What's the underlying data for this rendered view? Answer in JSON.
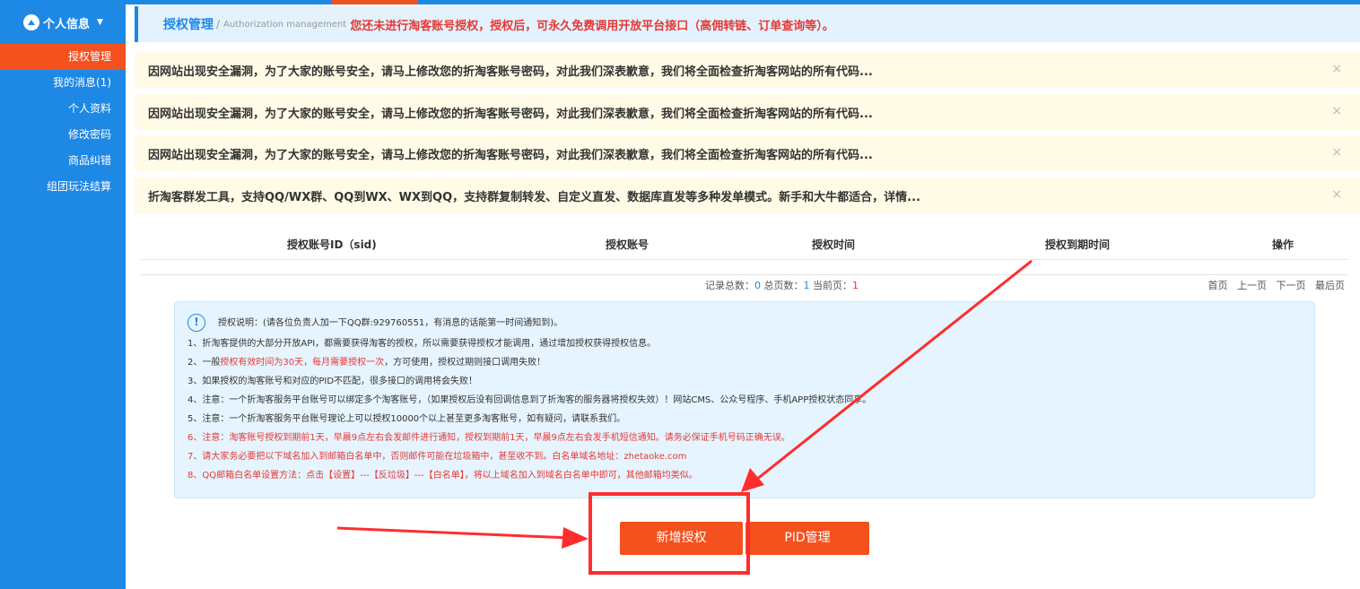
{
  "sidebar": {
    "header": "个人信息",
    "items": [
      {
        "label": "授权管理",
        "active": true
      },
      {
        "label": "我的消息(1)",
        "active": false
      },
      {
        "label": "个人资料",
        "active": false
      },
      {
        "label": "修改密码",
        "active": false
      },
      {
        "label": "商品纠错",
        "active": false
      },
      {
        "label": "组团玩法结算",
        "active": false
      }
    ]
  },
  "breadcrumb": {
    "title": "授权管理",
    "separator": "/",
    "subtitle": "Authorization management",
    "warning": "您还未进行淘客账号授权，授权后，可永久免费调用开放平台接口（高佣转链、订单查询等）。"
  },
  "notices": [
    {
      "text": "因网站出现安全漏洞，为了大家的账号安全，请马上修改您的折淘客账号密码，对此我们深表歉意，我们将全面检查折淘客网站的所有代码..."
    },
    {
      "text": "因网站出现安全漏洞，为了大家的账号安全，请马上修改您的折淘客账号密码，对此我们深表歉意，我们将全面检查折淘客网站的所有代码..."
    },
    {
      "text": "因网站出现安全漏洞，为了大家的账号安全，请马上修改您的折淘客账号密码，对此我们深表歉意，我们将全面检查折淘客网站的所有代码..."
    },
    {
      "text": "折淘客群发工具，支持QQ/WX群、QQ到WX、WX到QQ，支持群复制转发、自定义直发、数据库直发等多种发单模式。新手和大牛都适合，详情..."
    }
  ],
  "notice_close": "×",
  "table": {
    "columns": [
      "授权账号ID（sid)",
      "授权账号",
      "授权时间",
      "授权到期时间",
      "操作"
    ]
  },
  "pager": {
    "total_label": "记录总数：",
    "total": "0",
    "pages_label": "总页数：",
    "pages": "1",
    "current_label": "当前页：",
    "current": "1",
    "links": [
      "首页",
      "上一页",
      "下一页",
      "最后页"
    ]
  },
  "info": {
    "icon": "!",
    "header": "授权说明：(请各位负责人加一下QQ群:929760551，有消息的话能第一时间通知到)。",
    "line1": "1、折淘客提供的大部分开放API，都需要获得淘客的授权，所以需要获得授权才能调用，通过增加授权获得授权信息。",
    "line2_a": "2、一般",
    "line2_b": "授权有效时间为30天，每月需要授权一次",
    "line2_c": "，方可使用，授权过期则接口调用失败！",
    "line3": "3、如果授权的淘客账号和对应的PID不匹配，很多接口的调用将会失败！",
    "line4": "4、注意：一个折淘客服务平台账号可以绑定多个淘客账号，（如果授权后没有回调信息到了折淘客的服务器将授权失效）！网站CMS、公众号程序、手机APP授权状态同享。",
    "line5": "5、注意：一个折淘客服务平台账号理论上可以授权10000个以上甚至更多淘客账号，如有疑问，请联系我们。",
    "line6": "6、注意：淘客账号授权到期前1天，早晨9点左右会发邮件进行通知，授权到期前1天，早晨9点左右会发手机短信通知。请务必保证手机号码正确无误。",
    "line7": "7、请大家务必要把以下域名加入到邮箱白名单中，否则邮件可能在垃圾箱中，甚至收不到。白名单域名地址：zhetaoke.com",
    "line8": "8、QQ邮箱白名单设置方法：点击【设置】---【反垃圾】---【白名单】，将以上域名加入到域名白名单中即可，其他邮箱均类似。"
  },
  "buttons": {
    "add_auth": "新增授权",
    "pid_manage": "PID管理"
  },
  "colors": {
    "sidebar": "#1e88e5",
    "accent": "#f4511e",
    "annotation": "#ff2d2d"
  }
}
